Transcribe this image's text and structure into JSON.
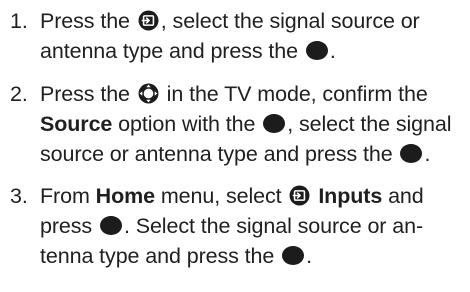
{
  "steps": [
    {
      "number": "1.",
      "parts": {
        "a": "Press the",
        "b": ", select the signal source or antenna type and press the",
        "c": "."
      }
    },
    {
      "number": "2.",
      "parts": {
        "a": "Press the",
        "b": "in the TV mode, confirm the",
        "source_bold": "Source",
        "c": "option with the",
        "d": ", select the signal source or antenna type and press the",
        "e": "."
      }
    },
    {
      "number": "3.",
      "parts": {
        "a": "From",
        "home_bold": "Home",
        "b": "menu, select",
        "inputs_bold": "Inputs",
        "c": "and press",
        "d": ". Select the signal source or an- tenna type and press the",
        "e": "."
      }
    }
  ],
  "icons": {
    "input": "input-source-icon",
    "navigation": "navigation-pad-icon",
    "ok": "ok-button-icon"
  },
  "colors": {
    "text": "#1f1f1f",
    "icon": "#1c1c1c"
  }
}
